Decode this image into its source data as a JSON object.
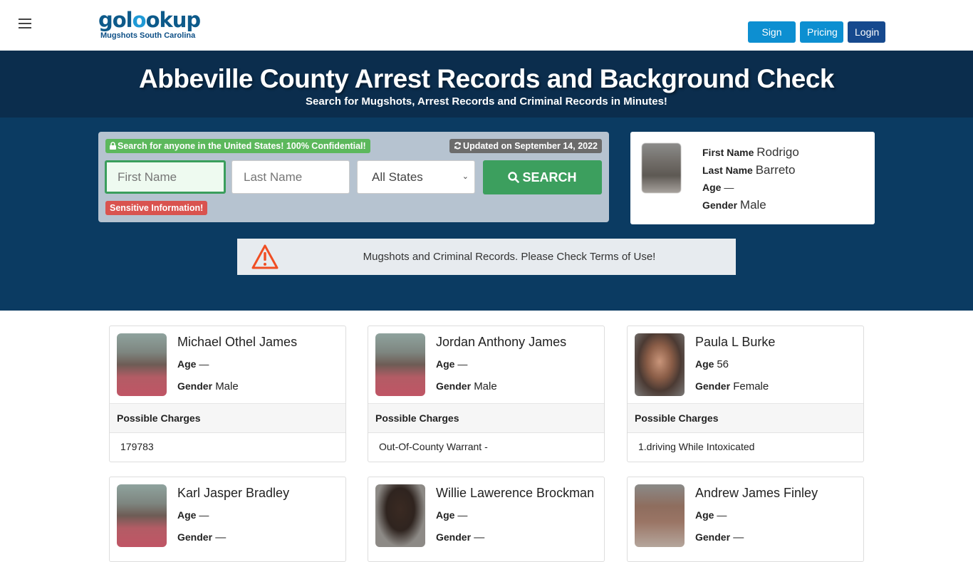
{
  "header": {
    "logo_text_a": "gol",
    "logo_text_b": "o",
    "logo_text_c": "okup",
    "logo_subtitle": "Mugshots South Carolina",
    "nav": {
      "signup": "Sign Up",
      "pricing": "Pricing",
      "login": "Login"
    },
    "colors": {
      "signup": "#0d8fd1",
      "pricing": "#0d8fd1",
      "login": "#16498e"
    }
  },
  "hero": {
    "title": "Abbeville County Arrest Records and Background Check",
    "subtitle": "Search for Mugshots, Arrest Records and Criminal Records in Minutes!"
  },
  "search": {
    "confidential_badge": "Search for anyone in the United States! 100% Confidential!",
    "updated_badge": "Updated on September 14, 2022",
    "first_name_placeholder": "First Name",
    "last_name_placeholder": "Last Name",
    "state_selected": "All States",
    "search_button": "SEARCH",
    "sensitive_badge": "Sensitive Information!"
  },
  "featured": {
    "first_name_label": "First Name",
    "first_name": "Rodrigo",
    "last_name_label": "Last Name",
    "last_name": "Barreto",
    "age_label": "Age",
    "age": "—",
    "gender_label": "Gender",
    "gender": "Male"
  },
  "notice": {
    "message": "Mugshots and Criminal Records. Please Check Terms of Use!"
  },
  "labels": {
    "age": "Age",
    "gender": "Gender",
    "possible_charges": "Possible Charges"
  },
  "records": [
    {
      "name": "Michael Othel James",
      "age": "—",
      "gender": "Male",
      "charges": "179783"
    },
    {
      "name": "Jordan Anthony James",
      "age": "—",
      "gender": "Male",
      "charges": "Out-Of-County Warrant -"
    },
    {
      "name": "Paula L Burke",
      "age": "56",
      "gender": "Female",
      "charges": "1.driving While Intoxicated"
    },
    {
      "name": "Karl Jasper Bradley",
      "age": "—",
      "gender": "—",
      "charges": ""
    },
    {
      "name": "Willie Lawerence Brockman",
      "age": "—",
      "gender": "—",
      "charges": ""
    },
    {
      "name": "Andrew James Finley",
      "age": "—",
      "gender": "—",
      "charges": ""
    }
  ]
}
